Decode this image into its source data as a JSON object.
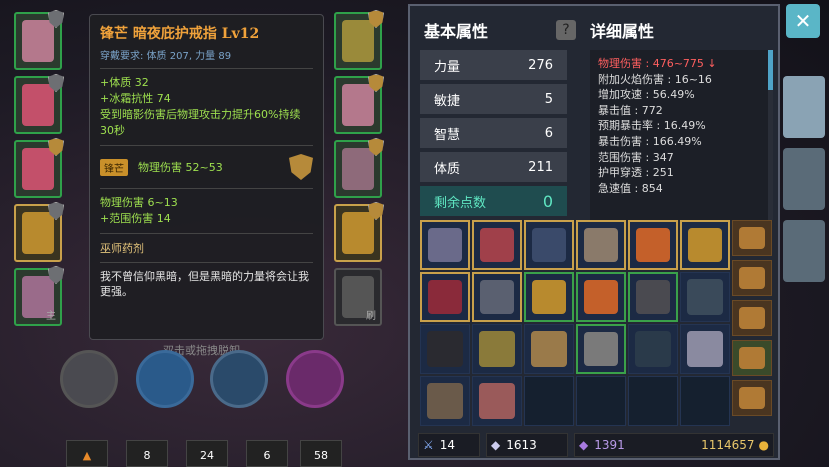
{
  "equipment_left": {
    "main_tag": "主"
  },
  "equipment_right": {
    "refresh_tag": "刷"
  },
  "skills": {
    "hint": "双击或拖拽脱卸"
  },
  "belt": [
    {
      "count": "8"
    },
    {
      "count": "24"
    },
    {
      "count": "6"
    },
    {
      "count": "58"
    }
  ],
  "tooltip": {
    "name": "锋芒 暗夜庇护戒指 Lv12",
    "requirement": "穿戴要求: 体质 207, 力量 89",
    "bonuses": [
      "+体质 32",
      "+冰霜抗性 74",
      "受到暗影伤害后物理攻击力提升60%持续30秒"
    ],
    "set_tag": "锋芒",
    "set_effect": "物理伤害 52~53",
    "base_stats": [
      "物理伤害 6~13",
      "+范围伤害 14"
    ],
    "potion": "巫师药剂",
    "description": "我不曾信仰黑暗，但是黑暗的力量将会让我更强。"
  },
  "panel": {
    "basic_title": "基本属性",
    "detail_title": "详细属性",
    "stats": [
      {
        "label": "力量",
        "value": "276"
      },
      {
        "label": "敏捷",
        "value": "5"
      },
      {
        "label": "智慧",
        "value": "6"
      },
      {
        "label": "体质",
        "value": "211"
      }
    ],
    "remaining_label": "剩余点数",
    "remaining_value": "0",
    "details": [
      {
        "text": "物理伤害 : 476~775 ↓",
        "red": true
      },
      {
        "text": "附加火焰伤害 : 16~16"
      },
      {
        "text": "增加攻速 : 56.49%"
      },
      {
        "text": "暴击值 : 772"
      },
      {
        "text": "预期暴击率 : 16.49%"
      },
      {
        "text": "暴击伤害 : 166.49%"
      },
      {
        "text": "范围伤害 : 347"
      },
      {
        "text": "护甲穿透 : 251"
      },
      {
        "text": "急速值 : 854"
      }
    ],
    "currency": {
      "a": "14",
      "b": "1613",
      "c": "1391",
      "gold": "1114657"
    }
  },
  "close_label": "✕"
}
